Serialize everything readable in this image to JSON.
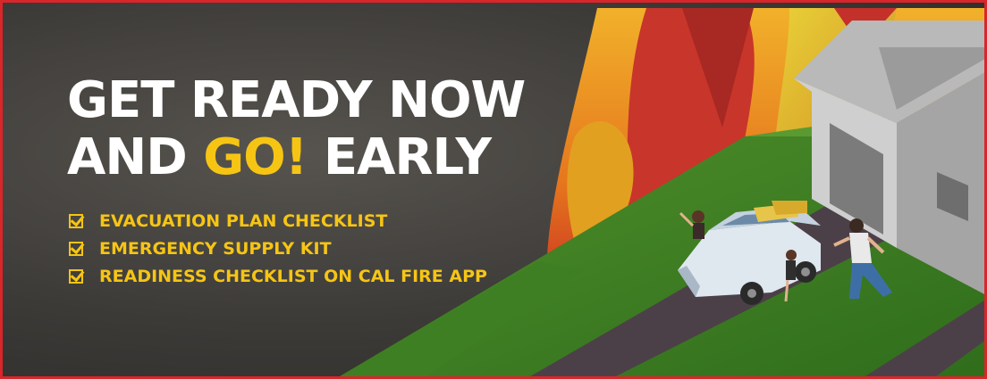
{
  "banner": {
    "headline": {
      "line1": "GET READY NOW",
      "line2_start": "AND",
      "line2_accent": "GO!",
      "line2_end": "EARLY"
    },
    "checklist": [
      "EVACUATION PLAN CHECKLIST",
      "EMERGENCY SUPPLY KIT",
      "READINESS CHECKLIST ON CAL FIRE APP"
    ]
  },
  "colors": {
    "accent": "#f6c514",
    "border": "#d9262a",
    "headline_text": "#ffffff",
    "background": "#3c3a37"
  },
  "icons": [
    "checkbox-checked-icon"
  ]
}
